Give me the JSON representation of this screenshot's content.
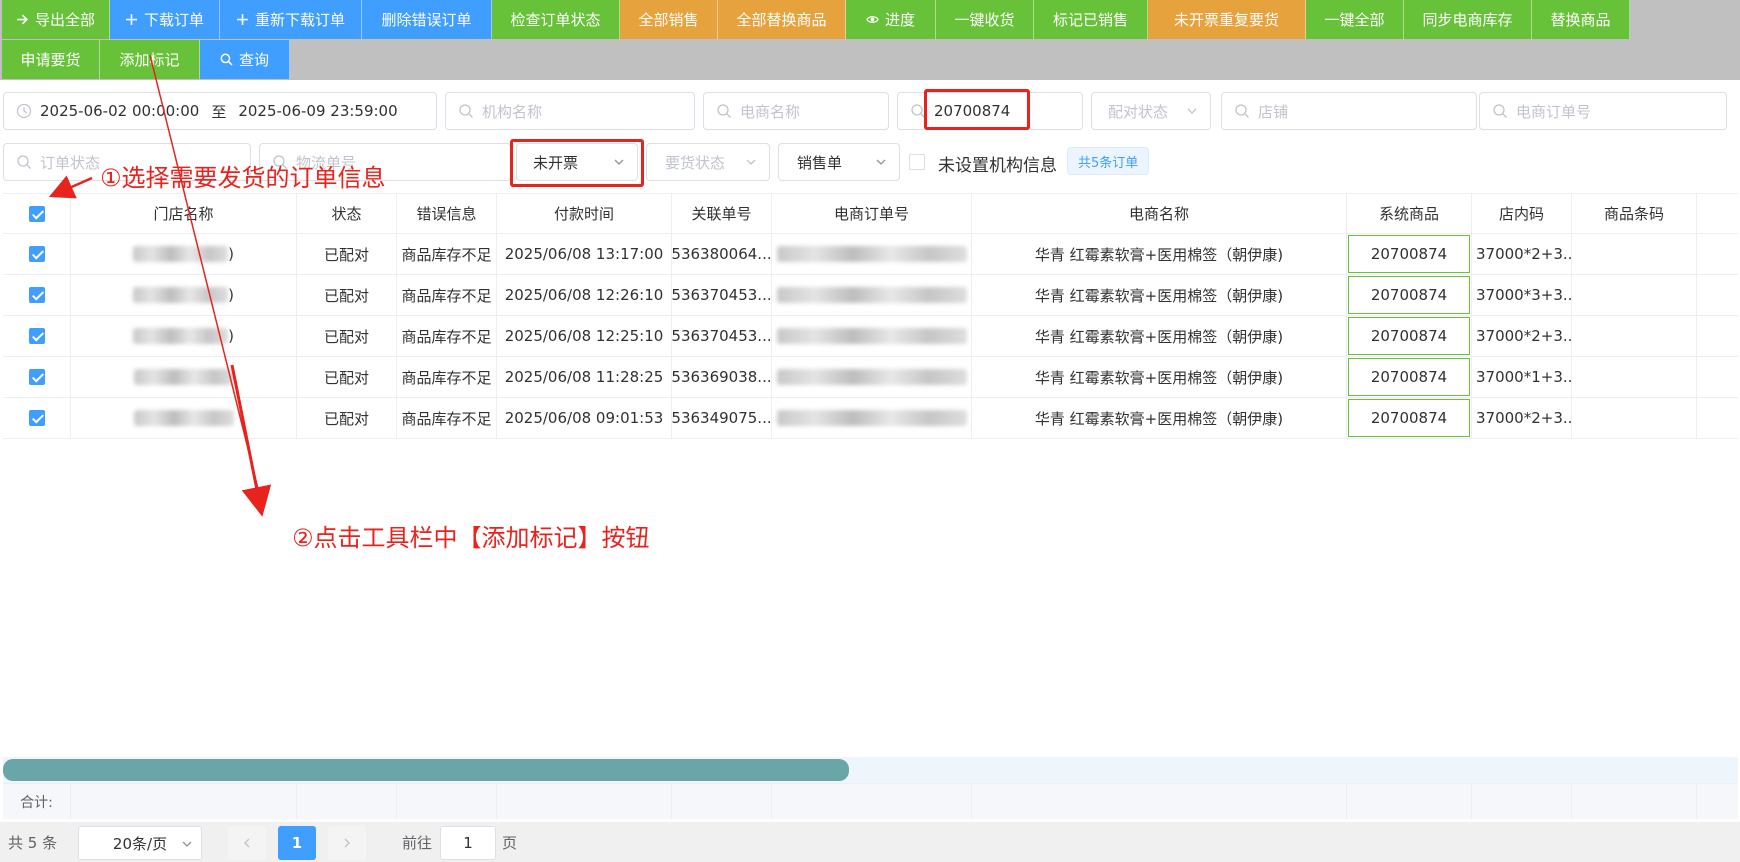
{
  "toolbar": {
    "row1": [
      {
        "label": "导出全部",
        "icon": "arrow-right-icon",
        "color": "#67c23a"
      },
      {
        "label": "下载订单",
        "icon": "plus-icon",
        "color": "#409eff"
      },
      {
        "label": "重新下载订单",
        "icon": "plus-icon",
        "color": "#409eff"
      },
      {
        "label": "删除错误订单",
        "icon": "",
        "color": "#409eff"
      },
      {
        "label": "检查订单状态",
        "icon": "",
        "color": "#67c23a"
      },
      {
        "label": "全部销售",
        "icon": "",
        "color": "#e6a23c"
      },
      {
        "label": "全部替换商品",
        "icon": "",
        "color": "#e6a23c"
      },
      {
        "label": "进度",
        "icon": "eye-icon",
        "color": "#67c23a"
      },
      {
        "label": "一键收货",
        "icon": "",
        "color": "#67c23a"
      },
      {
        "label": "标记已销售",
        "icon": "",
        "color": "#67c23a"
      },
      {
        "label": "未开票重复要货",
        "icon": "",
        "color": "#e6a23c"
      },
      {
        "label": "一键全部",
        "icon": "",
        "color": "#67c23a"
      },
      {
        "label": "同步电商库存",
        "icon": "",
        "color": "#67c23a"
      },
      {
        "label": "替换商品",
        "icon": "",
        "color": "#67c23a"
      }
    ],
    "row2": [
      {
        "label": "申请要货",
        "icon": "",
        "color": "#67c23a"
      },
      {
        "label": "添加标记",
        "icon": "",
        "color": "#67c23a"
      },
      {
        "label": "查询",
        "icon": "search-icon",
        "color": "#409eff"
      }
    ]
  },
  "filters": {
    "date_start": "2025-06-02 00:00:00",
    "date_sep": "至",
    "date_end": "2025-06-09 23:59:00",
    "org_name_placeholder": "机构名称",
    "ecom_name_placeholder": "电商名称",
    "product_code_value": "20700874",
    "match_status_placeholder": "配对状态",
    "shop_placeholder": "店铺",
    "ecom_order_placeholder": "电商订单号",
    "order_status_placeholder": "订单状态",
    "logistics_placeholder": "物流单号",
    "invoice_select_value": "未开票",
    "request_status_placeholder": "要货状态",
    "order_type_value": "销售单",
    "no_org_label": "未设置机构信息",
    "total_tag": "共5条订单"
  },
  "table": {
    "headers": [
      "门店名称",
      "状态",
      "错误信息",
      "付款时间",
      "关联单号",
      "电商订单号",
      "电商名称",
      "系统商品",
      "店内码",
      "商品条码"
    ],
    "rows": [
      {
        "store_suffix": ")",
        "status": "已配对",
        "error": "商品库存不足",
        "pay_time": "2025/06/08 13:17:00",
        "ref_no": "536380064...",
        "ecom_name": "华青 红霉素软膏+医用棉签（朝伊康)",
        "sys_code": "20700874",
        "store_code": "37000*2+3...",
        "barcode": ""
      },
      {
        "store_suffix": ")",
        "status": "已配对",
        "error": "商品库存不足",
        "pay_time": "2025/06/08 12:26:10",
        "ref_no": "536370453...",
        "ecom_name": "华青 红霉素软膏+医用棉签（朝伊康)",
        "sys_code": "20700874",
        "store_code": "37000*3+3...",
        "barcode": ""
      },
      {
        "store_suffix": ")",
        "status": "已配对",
        "error": "商品库存不足",
        "pay_time": "2025/06/08 12:25:10",
        "ref_no": "536370453...",
        "ecom_name": "华青 红霉素软膏+医用棉签（朝伊康)",
        "sys_code": "20700874",
        "store_code": "37000*2+3...",
        "barcode": ""
      },
      {
        "store_suffix": "",
        "status": "已配对",
        "error": "商品库存不足",
        "pay_time": "2025/06/08 11:28:25",
        "ref_no": "536369038...",
        "ecom_name": "华青 红霉素软膏+医用棉签（朝伊康)",
        "sys_code": "20700874",
        "store_code": "37000*1+3...",
        "barcode": ""
      },
      {
        "store_suffix": "",
        "status": "已配对",
        "error": "商品库存不足",
        "pay_time": "2025/06/08 09:01:53",
        "ref_no": "536349075...",
        "ecom_name": "华青 红霉素软膏+医用棉签（朝伊康)",
        "sys_code": "20700874",
        "store_code": "37000*2+3...",
        "barcode": ""
      }
    ],
    "summary_label": "合计:"
  },
  "pagination": {
    "total": "共 5 条",
    "page_size": "20条/页",
    "current_page": "1",
    "goto_label": "前往",
    "goto_value": "1",
    "page_suffix": "页"
  },
  "annotations": {
    "step1": "①选择需要发货的订单信息",
    "step2": "②点击工具栏中【添加标记】按钮"
  }
}
